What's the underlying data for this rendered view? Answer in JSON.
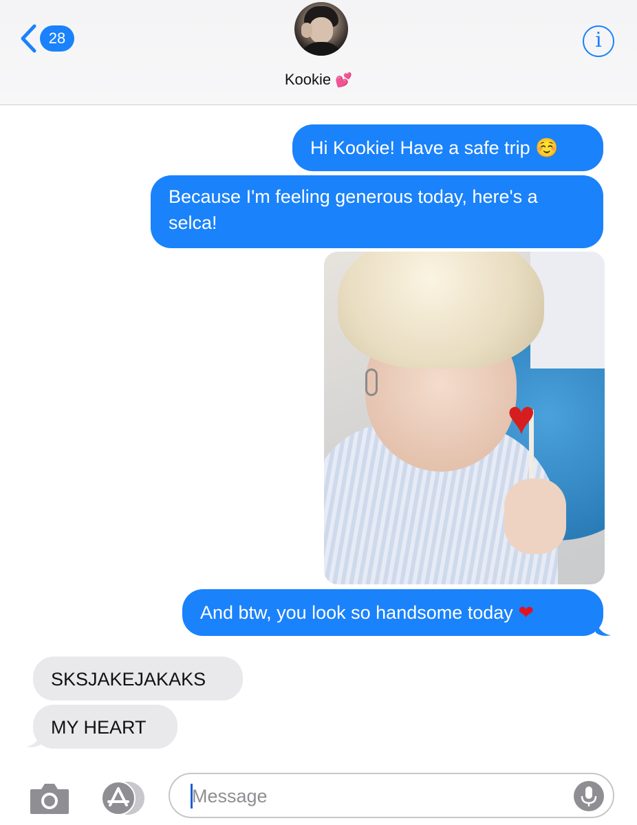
{
  "header": {
    "back_count": "28",
    "contact_name": "Kookie",
    "contact_emoji": "💕",
    "info_label": "i"
  },
  "messages": [
    {
      "direction": "outgoing",
      "text": "Hi Kookie! Have a safe trip",
      "emoji": "☺️"
    },
    {
      "direction": "outgoing",
      "text": "Because I'm feeling generous today, here's a selca!"
    },
    {
      "direction": "outgoing",
      "type": "photo"
    },
    {
      "direction": "outgoing",
      "text": "And btw, you look so handsome today",
      "emoji": "❤"
    },
    {
      "direction": "incoming",
      "text": "SKSJAKEJAKAKS"
    },
    {
      "direction": "incoming",
      "text": "MY HEART"
    }
  ],
  "composer": {
    "placeholder": "Message"
  },
  "icons": {
    "back": "chevron-left-icon",
    "info": "info-icon",
    "camera": "camera-icon",
    "apps": "app-store-icon",
    "mic": "microphone-icon"
  },
  "colors": {
    "accent": "#1a82fb",
    "incoming_bubble": "#e9e9eb"
  }
}
